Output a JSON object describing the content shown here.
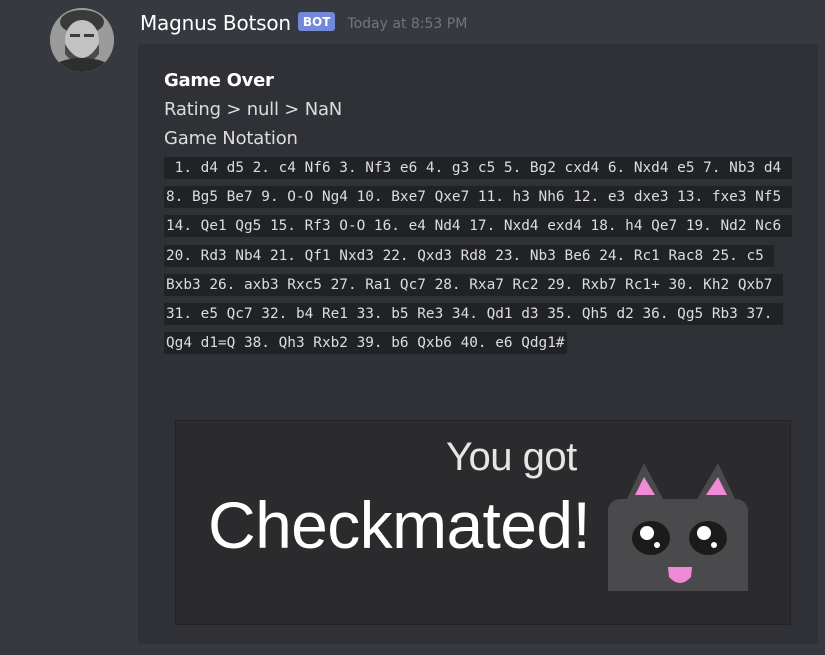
{
  "message": {
    "author": "Magnus Botson",
    "bot_tag": "BOT",
    "timestamp": "Today at 8:53 PM"
  },
  "embed": {
    "title": "Game Over",
    "rating_line": "Rating > null > NaN",
    "notation_label": "Game Notation",
    "notation": " 1. d4 d5 2. c4 Nf6 3. Nf3 e6 4. g3 c5 5. Bg2 cxd4 6. Nxd4 e5 7. Nb3 d4 8. Bg5 Be7 9. O-O Ng4 10. Bxe7 Qxe7 11. h3 Nh6 12. e3 dxe3 13. fxe3 Nf5 14. Qe1 Qg5 15. Rf3 O-O 16. e4 Nd4 17. Nxd4 exd4 18. h4 Qe7 19. Nd2 Nc6 20. Rd3 Nb4 21. Qf1 Nxd3 22. Qxd3 Rd8 23. Nb3 Be6 24. Rc1 Rac8 25. c5 Bxb3 26. axb3 Rxc5 27. Ra1 Qc7 28. Rxa7 Rc2 29. Rxb7 Rc1+ 30. Kh2 Qxb7 31. e5 Qc7 32. b4 Re1 33. b5 Re3 34. Qd1 d3 35. Qh5 d2 36. Qg5 Rb3 37. Qg4 d1=Q 38. Qh3 Rxb2 39. b6 Qxb6 40. e6 Qdg1#",
    "image": {
      "line1": "You got",
      "line2": "Checkmated!",
      "icon": "cat-face-icon"
    }
  },
  "colors": {
    "background": "#36393f",
    "embed_background": "#2f3136",
    "code_background": "#202225",
    "bot_tag": "#7289da",
    "timestamp": "#72767d",
    "cat_body": "#4a4a4c",
    "cat_ear_inner": "#f08ad6",
    "cat_tongue": "#f08ad6"
  }
}
